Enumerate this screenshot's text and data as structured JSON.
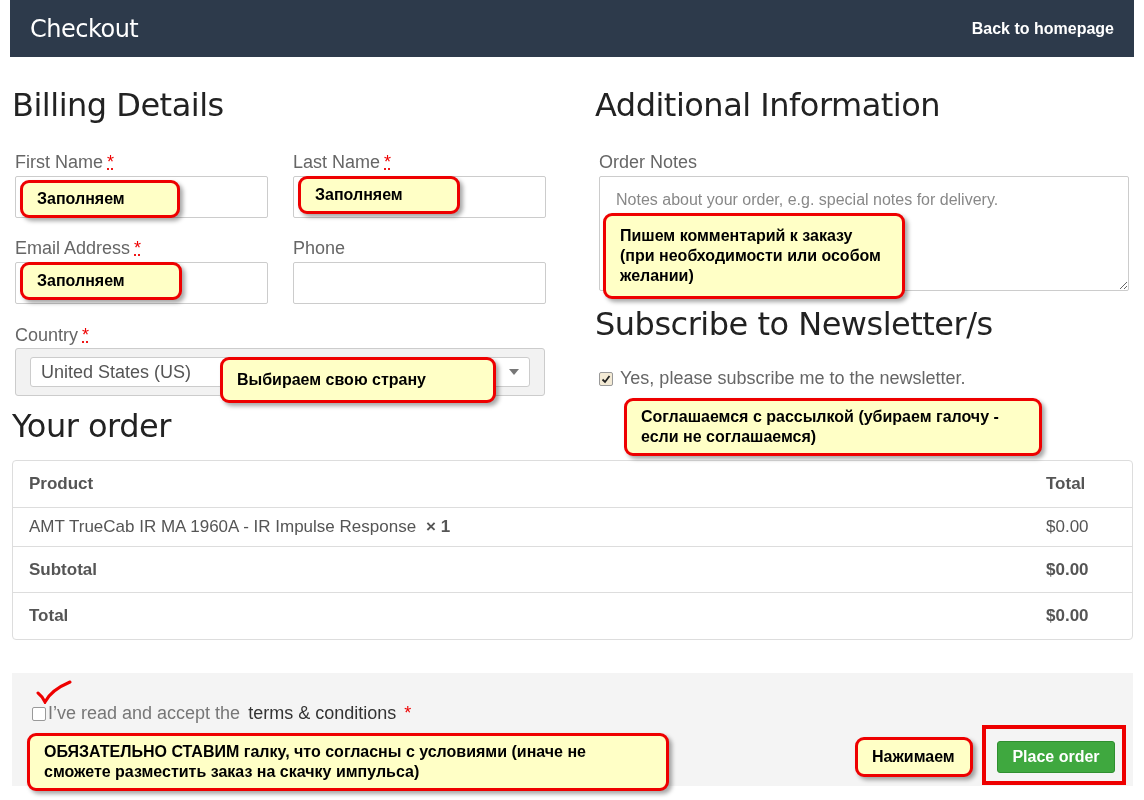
{
  "header": {
    "title": "Checkout",
    "link": "Back to homepage"
  },
  "billing": {
    "heading": "Billing Details",
    "fields": [
      {
        "label": "First Name",
        "required_mark": "*"
      },
      {
        "label": "Last Name",
        "required_mark": "*"
      },
      {
        "label": "Email Address",
        "required_mark": "*"
      },
      {
        "label": "Phone"
      }
    ],
    "country": {
      "label": "Country",
      "required_mark": "*",
      "value": "United States (US)"
    }
  },
  "additional": {
    "heading": "Additional Information",
    "notes": {
      "label": "Order Notes",
      "placeholder": "Notes about your order, e.g. special notes for delivery."
    }
  },
  "newsletter": {
    "heading": "Subscribe to Newsletter/s",
    "option": {
      "label": "Yes, please subscribe me to the newsletter.",
      "checked": true
    }
  },
  "order": {
    "heading": "Your order",
    "columns": [
      "Product",
      "Total"
    ],
    "rows": [
      {
        "kind": "item",
        "product": "AMT TrueCab IR MA 1960A - IR Impulse Response",
        "qty": "× 1",
        "total": "$0.00"
      },
      {
        "kind": "subtotal",
        "product": "Subtotal",
        "total": "$0.00"
      },
      {
        "kind": "total",
        "product": "Total",
        "total": "$0.00"
      }
    ]
  },
  "terms": {
    "text": "I’ve read and accept the",
    "link": "terms & conditions",
    "required_mark": "*",
    "checked": false
  },
  "place_order": "Place order",
  "callouts": [
    {
      "text": "Заполняем"
    },
    {
      "text": "Заполняем"
    },
    {
      "text": "Заполняем"
    },
    {
      "text": "Выбираем свою страну"
    },
    {
      "text": "Пишем комментарий к заказу (при необходимости или особом желании)"
    },
    {
      "text": "Соглашаемся с рассылкой (убираем галочу - если не соглашаемся)"
    },
    {
      "text": "ОБЯЗАТЕЛЬНО СТАВИМ галку, что согласны с условиями (иначе не сможете разместить заказ на скачку импульса)"
    },
    {
      "text": "Нажимаем"
    }
  ]
}
